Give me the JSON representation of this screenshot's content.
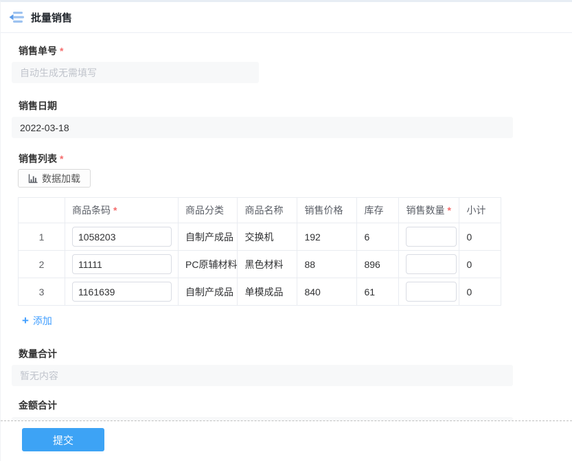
{
  "marks": {
    "required": "*"
  },
  "header": {
    "title": "批量销售"
  },
  "form": {
    "order_no": {
      "label": "销售单号",
      "required": true,
      "placeholder": "自动生成无需填写"
    },
    "sale_date": {
      "label": "销售日期",
      "value": "2022-03-18"
    },
    "sale_list": {
      "label": "销售列表",
      "required": true,
      "load_button_label": "数据加载",
      "add_label": "添加",
      "table": {
        "headers": {
          "index": "",
          "barcode": "商品条码",
          "category": "商品分类",
          "name": "商品名称",
          "price": "销售价格",
          "stock": "库存",
          "quantity": "销售数量",
          "subtotal": "小计"
        },
        "rows": [
          {
            "index": "1",
            "barcode": "1058203",
            "category": "自制产成品",
            "name": "交换机",
            "price": "192",
            "stock": "6",
            "quantity": "",
            "subtotal": "0"
          },
          {
            "index": "2",
            "barcode": "11111",
            "category": "PC原辅材料",
            "name": "黑色材料",
            "price": "88",
            "stock": "896",
            "quantity": "",
            "subtotal": "0"
          },
          {
            "index": "3",
            "barcode": "1161639",
            "category": "自制产成品",
            "name": "单模成品",
            "price": "840",
            "stock": "61",
            "quantity": "",
            "subtotal": "0"
          }
        ]
      }
    },
    "quantity_total": {
      "label": "数量合计",
      "placeholder": "暂无内容"
    },
    "amount_total": {
      "label": "金额合计"
    }
  },
  "footer": {
    "submit_label": "提交"
  },
  "colors": {
    "accent": "#409eff",
    "submit_button": "#3da3f5",
    "required_mark": "#f56c6c",
    "input_bg": "#f7f8f9",
    "table_border": "#e9ecf1"
  }
}
